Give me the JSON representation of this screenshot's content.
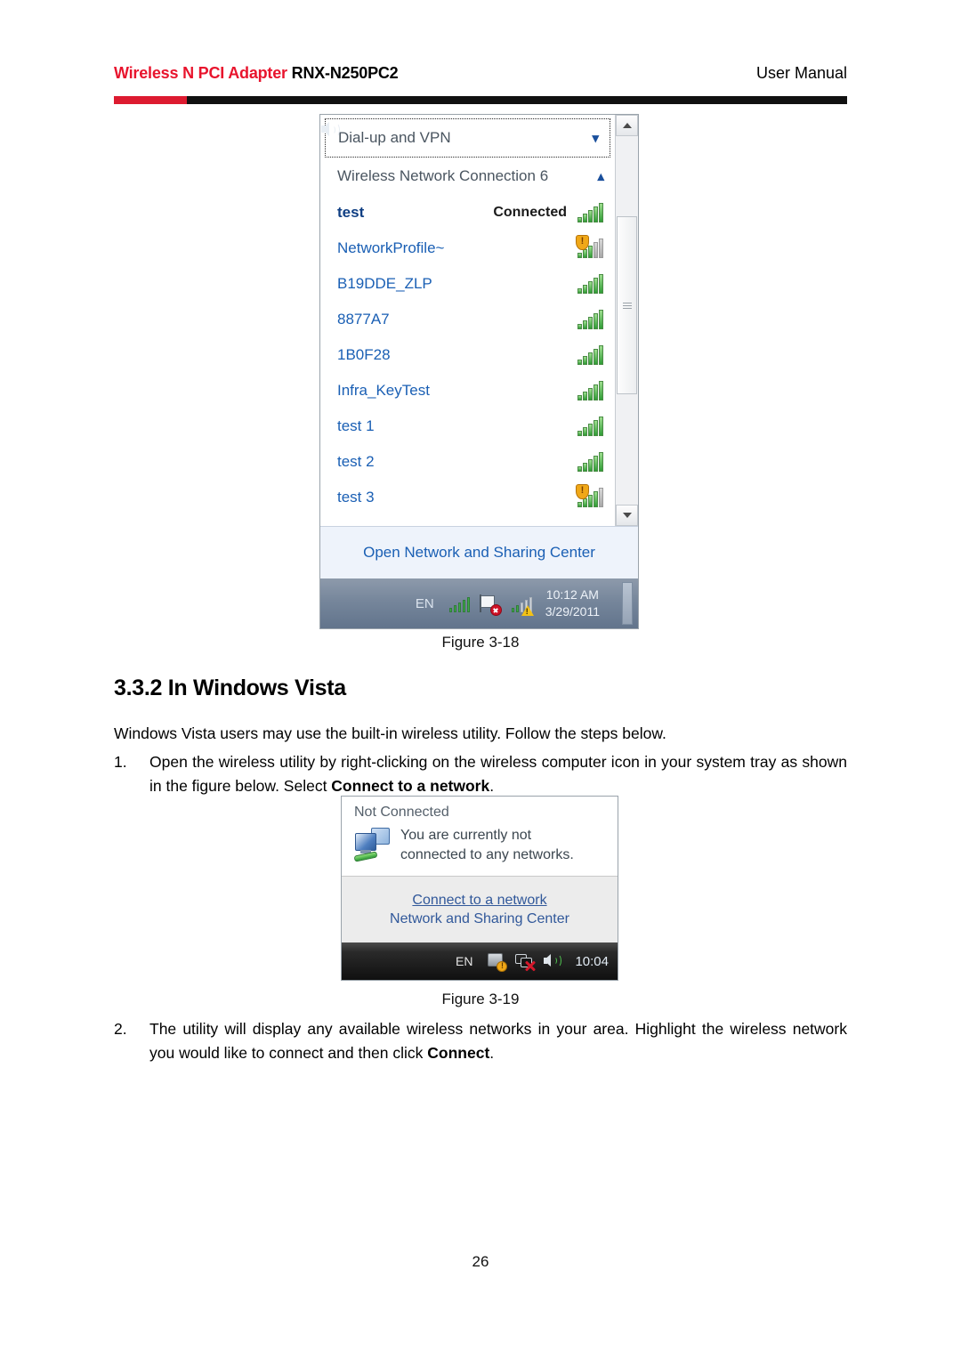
{
  "header": {
    "brand": "Wireless N PCI Adapter",
    "model": " RNX-N250PC2",
    "doc_type": "User Manual",
    "rule_red": "#dd1b30",
    "rule_black": "#111111"
  },
  "figure_3_18": {
    "caption": "Figure 3-18",
    "dialup_label": "Dial-up and VPN",
    "dialup_chevron": "chevron-down-icon",
    "connection_label": "Wireless Network Connection 6",
    "connection_chevron": "chevron-up-icon",
    "networks": [
      {
        "name": "test",
        "status": "Connected",
        "connected": true,
        "secured": true,
        "bars": 5
      },
      {
        "name": "NetworkProfile~",
        "status": "",
        "connected": false,
        "secured": false,
        "bars": 3
      },
      {
        "name": "B19DDE_ZLP",
        "status": "",
        "connected": false,
        "secured": true,
        "bars": 5
      },
      {
        "name": "8877A7",
        "status": "",
        "connected": false,
        "secured": true,
        "bars": 5
      },
      {
        "name": "1B0F28",
        "status": "",
        "connected": false,
        "secured": true,
        "bars": 5
      },
      {
        "name": "Infra_KeyTest",
        "status": "",
        "connected": false,
        "secured": true,
        "bars": 5
      },
      {
        "name": "test 1",
        "status": "",
        "connected": false,
        "secured": true,
        "bars": 5
      },
      {
        "name": "test 2",
        "status": "",
        "connected": false,
        "secured": true,
        "bars": 5
      },
      {
        "name": "test 3",
        "status": "",
        "connected": false,
        "secured": false,
        "bars": 4
      }
    ],
    "footer_link": "Open Network and Sharing Center",
    "taskbar": {
      "language": "EN",
      "icons": [
        "wireless-signal-icon",
        "network-flag-error-icon",
        "network-signal-warning-icon",
        "volume-speaker-icon"
      ],
      "time": "10:12 AM",
      "date": "3/29/2011"
    }
  },
  "figure_3_19": {
    "caption": "Figure 3-19",
    "title": "Not Connected",
    "message_line1": "You are currently not",
    "message_line2": "connected to any networks.",
    "icon": "two-monitors-network-icon",
    "links": [
      {
        "label": "Connect to a network",
        "underlined": true
      },
      {
        "label": "Network and Sharing Center",
        "underlined": false
      }
    ],
    "taskbar": {
      "language": "EN",
      "icons": [
        "ime-keyboard-warning-icon",
        "network-disconnected-icon",
        "volume-speaker-icon"
      ],
      "time": "10:04"
    }
  },
  "content": {
    "section_heading": "3.3.2 In Windows Vista",
    "intro": "Windows Vista users may use the built-in wireless utility. Follow the steps below.",
    "steps": [
      {
        "number": "1.",
        "text_before": "Open the wireless utility by right-clicking on the wireless computer icon in your system tray as shown in the figure below. Select ",
        "bold": "Connect to a network",
        "text_after": "."
      },
      {
        "number": "2.",
        "text_before": "The utility will display any available wireless networks in your area. Highlight the wireless network you would like to connect and then click ",
        "bold": "Connect",
        "text_after": "."
      }
    ]
  },
  "footer": {
    "page_number": "26"
  }
}
